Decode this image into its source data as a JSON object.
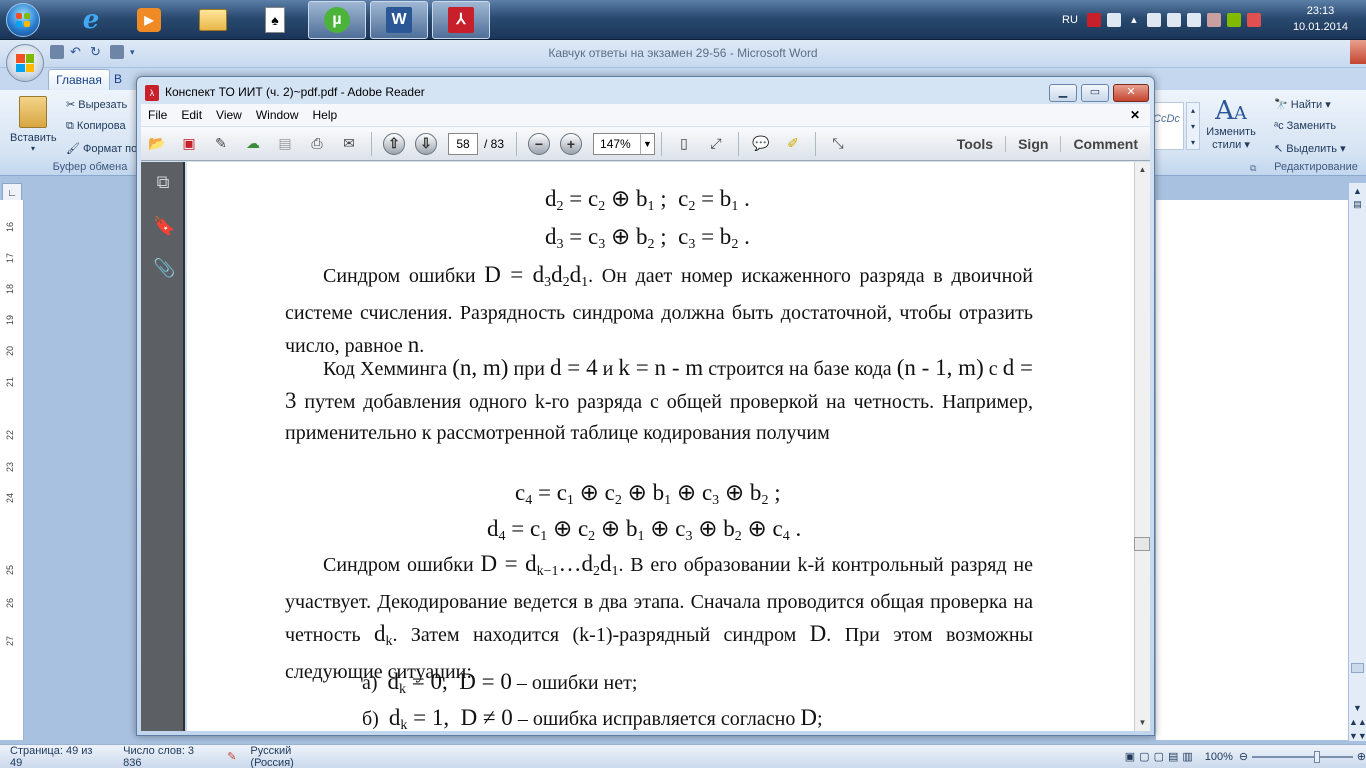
{
  "taskbar": {
    "lang": "RU",
    "time": "23:13",
    "date": "10.01.2014"
  },
  "word": {
    "title": "Кавчук ответы на экзамен 29-56 - Microsoft Word",
    "tabs": [
      "Главная",
      "В"
    ],
    "clipboard": {
      "paste": "Вставить",
      "cut": "Вырезать",
      "copy": "Копирова",
      "format": "Формат по",
      "group": "Буфер обмена"
    },
    "styles": {
      "preview": "CcDc",
      "change": "Изменить",
      "change2": "стили"
    },
    "editing": {
      "find": "Найти",
      "replace": "Заменить",
      "select": "Выделить",
      "group": "Редактирование"
    },
    "ruler_numbers": [
      "16",
      "17",
      "18",
      "19",
      "20",
      "21",
      "22",
      "23",
      "24",
      "25",
      "26",
      "27"
    ],
    "status": {
      "page": "Страница: 49 из 49",
      "words": "Число слов: 3 836",
      "lang": "Русский (Россия)",
      "zoom": "100%"
    }
  },
  "reader": {
    "title": "Конспект ТО ИИТ (ч. 2)~pdf.pdf - Adobe Reader",
    "menu": [
      "File",
      "Edit",
      "View",
      "Window",
      "Help"
    ],
    "page_current": "58",
    "page_total": "/ 83",
    "zoom": "147%",
    "right_links": [
      "Tools",
      "Sign",
      "Comment"
    ]
  },
  "pdf": {
    "line1": "Синдром ошибки",
    "line1b": ". Он дает номер искаженного разряда в двоичной системе счисления. Разрядность синдрома должна быть достаточной, чтобы отразить число, равное",
    "p2a": "Код Хемминга",
    "p2b": "при",
    "p2c": "и",
    "p2d": "строится на базе кода",
    "p2e": "с",
    "p2f": "путем добавления одного k-го разряда с общей проверкой на четность. Например, применительно к рассмотренной таблице кодирования получим",
    "p3a": "Синдром ошибки",
    "p3b": ". В его образовании k-й контрольный разряд не участвует. Декодирование ведется в два этапа. Сначала проводится общая проверка на четность",
    "p3c": ". Затем находится (k-1)-разрядный синдром",
    "p3d": "При этом возможны следующие ситуации:",
    "item_a_label": "а)",
    "item_a_text": "– ошибки нет;",
    "item_b_label": "б)",
    "item_b_text": "– ошибка исправляется согласно"
  }
}
